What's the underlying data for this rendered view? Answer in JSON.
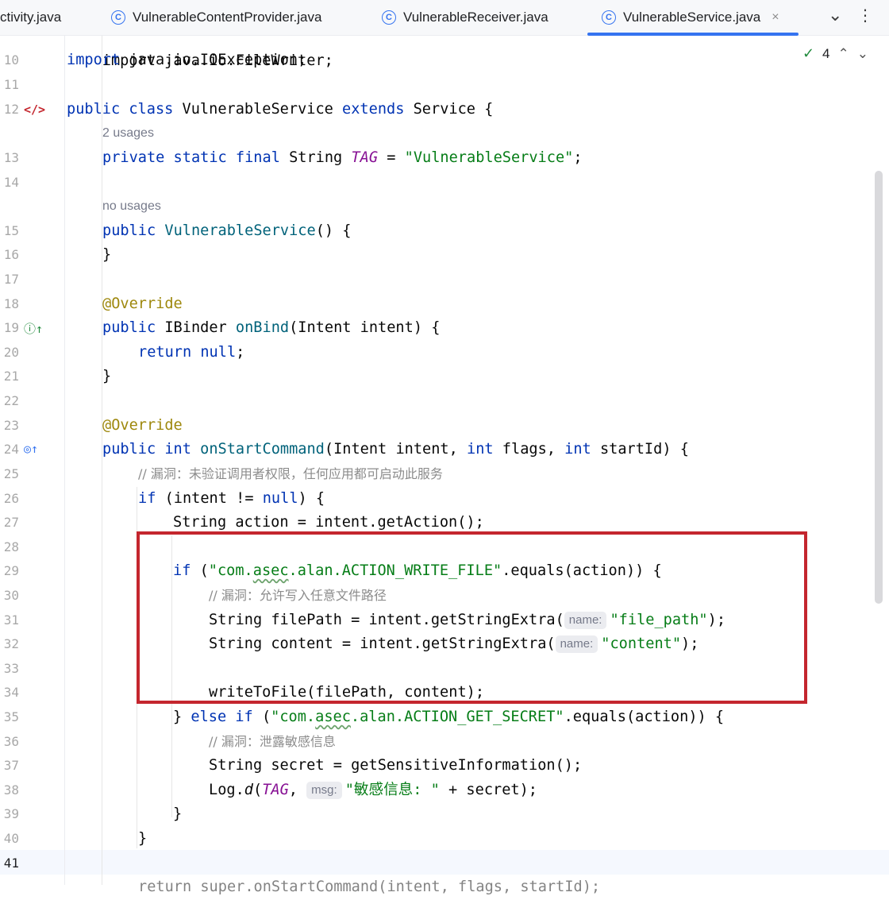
{
  "tabs": [
    {
      "label": "ctivity.java",
      "active": false
    },
    {
      "label": "VulnerableContentProvider.java",
      "active": false
    },
    {
      "label": "VulnerableReceiver.java",
      "active": false
    },
    {
      "label": "VulnerableService.java",
      "active": true
    }
  ],
  "tab_close_icon": "×",
  "tab_menu_icon": "⌄",
  "tab_more_icon": "⋮",
  "inspection": {
    "count": "4",
    "icon": "double-check-icon"
  },
  "usages": {
    "u1": "2 usages",
    "u2": "no usages"
  },
  "line_numbers": [
    "10",
    "11",
    "12",
    "13",
    "14",
    "15",
    "16",
    "17",
    "18",
    "19",
    "20",
    "21",
    "22",
    "23",
    "24",
    "25",
    "26",
    "27",
    "28",
    "29",
    "30",
    "31",
    "32",
    "33",
    "34",
    "35",
    "36",
    "37",
    "38",
    "39",
    "40",
    "41"
  ],
  "code": {
    "l9": "import java.io.FileWriter;",
    "l10_kw": "import",
    "l10_rest": " java.io.IOException;",
    "l12_kw1": "public class",
    "l12_name": " VulnerableService ",
    "l12_kw2": "extends",
    "l12_rest": " Service {",
    "l13_kw": "private static final",
    "l13_type": " String ",
    "l13_const": "TAG",
    "l13_eq": " = ",
    "l13_str": "\"VulnerableService\"",
    "l13_end": ";",
    "l15_kw": "public",
    "l15_name": "VulnerableService",
    "l15_rest": "() {",
    "l16": "}",
    "l18": "@Override",
    "l19_kw": "public",
    "l19_type": " IBinder ",
    "l19_fn": "onBind",
    "l19_rest": "(Intent intent) {",
    "l20_kw": "return null",
    "l20_end": ";",
    "l21": "}",
    "l23": "@Override",
    "l24_kw": "public int",
    "l24_fn": "onStartCommand",
    "l24_a": "(Intent intent, ",
    "l24_k2": "int",
    "l24_b": " flags, ",
    "l24_k3": "int",
    "l24_c": " startId) {",
    "l25_comment": "// 漏洞：未验证调用者权限，任何应用都可启动此服务",
    "l26_kw": "if",
    "l26_a": " (intent != ",
    "l26_null": "null",
    "l26_b": ") {",
    "l27": "String action = intent.getAction();",
    "l29_kw": "if",
    "l29_a": " (",
    "l29_s1": "\"com.",
    "l29_s2": "asec",
    "l29_s3": ".alan.ACTION_WRITE_FILE\"",
    "l29_b": ".equals(action)) {",
    "l30_comment": "// 漏洞：允许写入任意文件路径",
    "l31_a": "String filePath = intent.getStringExtra(",
    "l31_hint": "name:",
    "l31_str": "\"file_path\"",
    "l31_b": ");",
    "l32_a": "String content = intent.getStringExtra(",
    "l32_hint": "name:",
    "l32_str": "\"content\"",
    "l32_b": ");",
    "l34": "writeToFile(filePath, content);",
    "l35_a": "} ",
    "l35_kw": "else if",
    "l35_b": " (",
    "l35_s1": "\"com.",
    "l35_s2": "asec",
    "l35_s3": ".alan.ACTION_GET_SECRET\"",
    "l35_c": ".equals(action)) {",
    "l36_comment": "// 漏洞：泄露敏感信息",
    "l37": "String secret = getSensitiveInformation();",
    "l38_a": "Log.",
    "l38_fn": "d",
    "l38_b": "(",
    "l38_const": "TAG",
    "l38_c": ", ",
    "l38_hint": "msg:",
    "l38_str": "\"敏感信息: \"",
    "l38_d": " + secret);",
    "l39": "}",
    "l40": "}",
    "l42_partial": "return super.onStartCommand(intent, flags, startId);"
  },
  "colors": {
    "accent": "#3574f0",
    "highlight_box": "#c4262e",
    "keyword": "#0033b3",
    "string": "#067d17"
  }
}
